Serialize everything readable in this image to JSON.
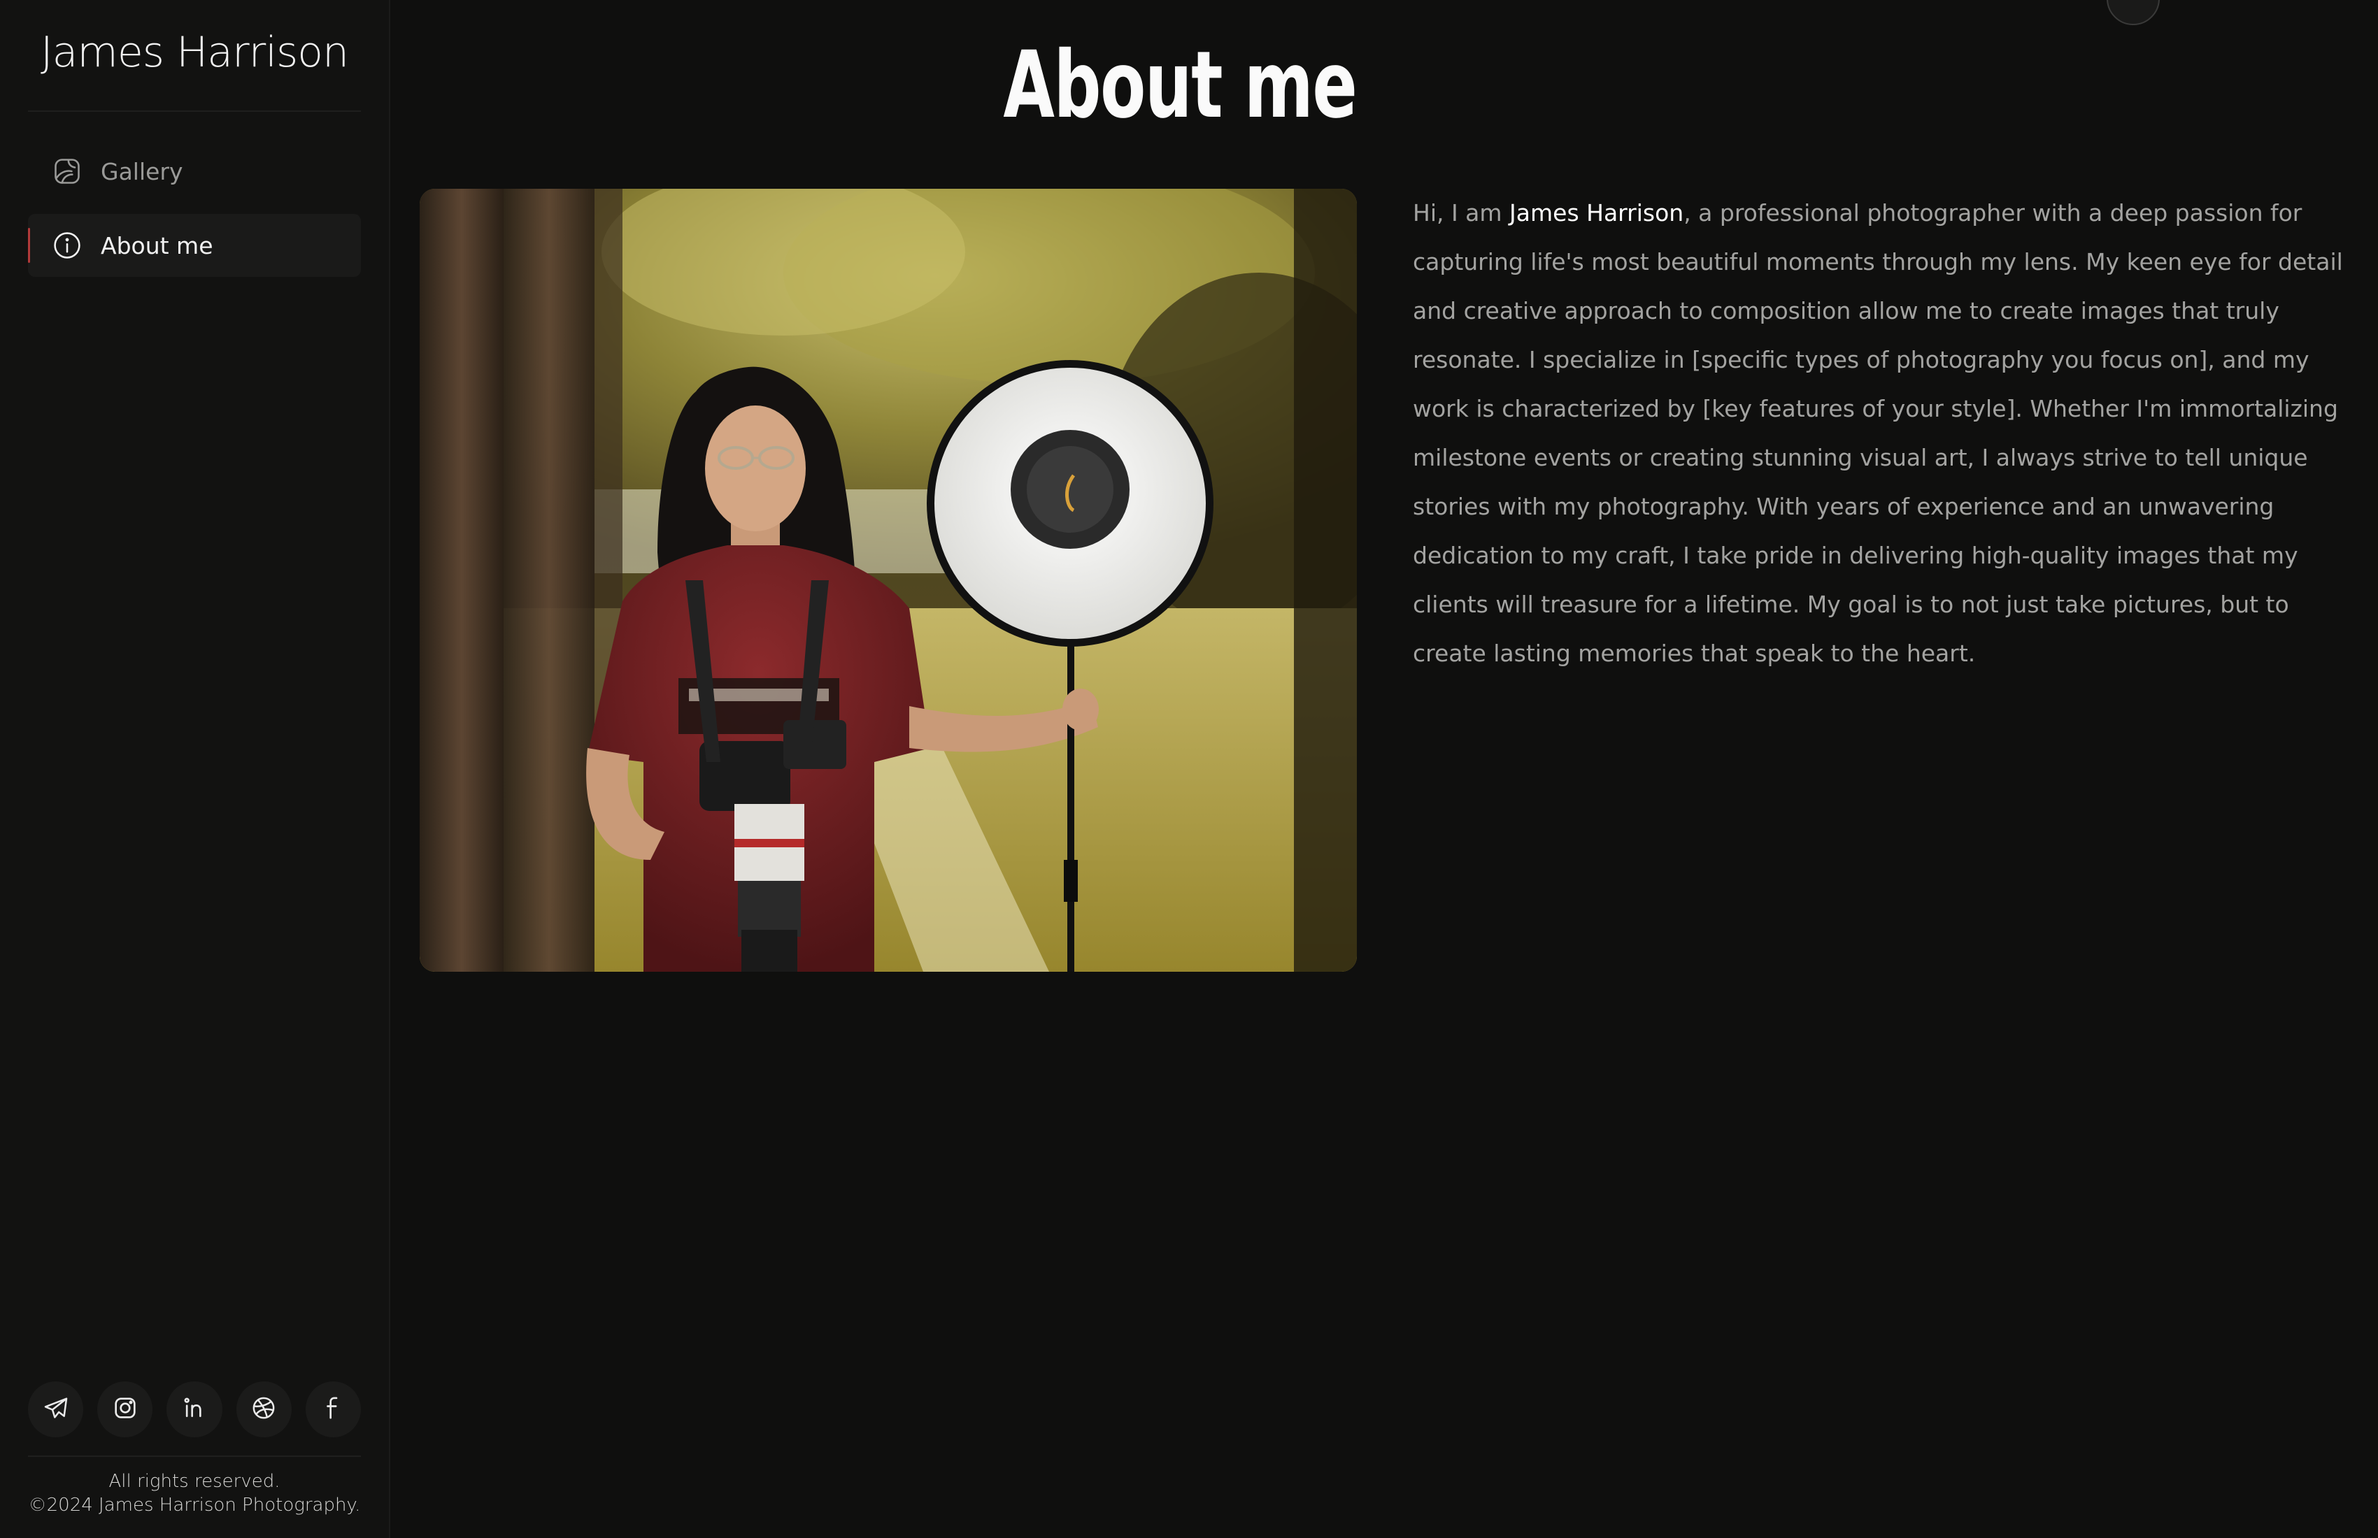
{
  "sidebar": {
    "brand": "James Harrison",
    "nav": [
      {
        "label": "Gallery",
        "icon": "gallery-icon",
        "active": false
      },
      {
        "label": "About me",
        "icon": "info-icon",
        "active": true
      }
    ],
    "socials": [
      {
        "icon": "telegram-icon"
      },
      {
        "icon": "instagram-icon"
      },
      {
        "icon": "linkedin-icon"
      },
      {
        "icon": "dribbble-icon"
      },
      {
        "icon": "facebook-icon"
      }
    ],
    "footer": {
      "line1": "All rights reserved.",
      "line2": "©2024 James Harrison Photography."
    }
  },
  "main": {
    "title": "About me",
    "photo": {
      "icon": "photographer-portrait-image"
    },
    "bio": {
      "intro": "Hi, I am ",
      "name": "James Harrison",
      "text": ", a professional photographer with a deep passion for capturing life's most beautiful moments through my lens. My keen eye for detail and creative approach to composition allow me to create images that truly resonate. I specialize in [specific types of photography you focus on], and my work is characterized by [key features of your style]. Whether I'm immortalizing milestone events or creating stunning visual art, I always strive to tell unique stories with my photography. With years of experience and an unwavering dedication to my craft, I take pride in delivering high-quality images that my clients will treasure for a lifetime. My goal is to not just take pictures, but to create lasting memories that speak to the heart."
    }
  },
  "colors": {
    "background": "#0f0f0e",
    "sidebar": "#121211",
    "accent": "#b23a3a",
    "text_primary": "#f2f2f2",
    "text_muted": "#a3a3a1"
  }
}
